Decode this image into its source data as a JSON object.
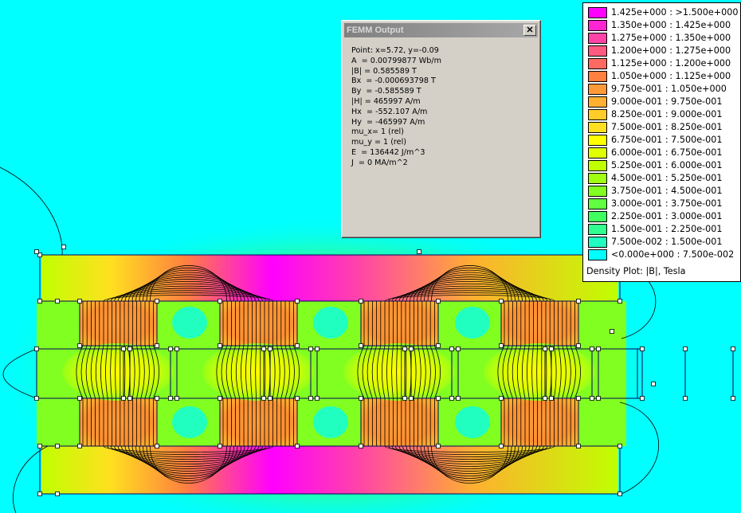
{
  "output_window": {
    "title": "FEMM Output",
    "lines": [
      "Point: x=5.72, y=-0.09",
      "A  = 0.00799877 Wb/m",
      "|B| = 0.585589 T",
      "Bx  = -0.000693798 T",
      "By  = -0.585589 T",
      "|H| = 465997 A/m",
      "Hx  = -552.107 A/m",
      "Hy  = -465997 A/m",
      "mu_x= 1 (rel)",
      "mu_y = 1 (rel)",
      "E  = 136442 J/m^3",
      "J  = 0 MA/m^2"
    ]
  },
  "legend": {
    "caption": "Density Plot: |B|, Tesla",
    "entries": [
      {
        "label": "1.425e+000 : >1.500e+000",
        "color": "#ff00ff"
      },
      {
        "label": "1.350e+000 : 1.425e+000",
        "color": "#ff26d2"
      },
      {
        "label": "1.275e+000 : 1.350e+000",
        "color": "#ff44a8"
      },
      {
        "label": "1.200e+000 : 1.275e+000",
        "color": "#ff5a80"
      },
      {
        "label": "1.125e+000 : 1.200e+000",
        "color": "#ff6a60"
      },
      {
        "label": "1.050e+000 : 1.125e+000",
        "color": "#ff8040"
      },
      {
        "label": "9.750e-001 : 1.050e+000",
        "color": "#ff9a38"
      },
      {
        "label": "9.000e-001 : 9.750e-001",
        "color": "#ffb030"
      },
      {
        "label": "8.250e-001 : 9.000e-001",
        "color": "#ffcc28"
      },
      {
        "label": "7.500e-001 : 8.250e-001",
        "color": "#ffe020"
      },
      {
        "label": "6.750e-001 : 7.500e-001",
        "color": "#ffff00"
      },
      {
        "label": "6.000e-001 : 6.750e-001",
        "color": "#e0ff00"
      },
      {
        "label": "5.250e-001 : 6.000e-001",
        "color": "#c0ff00"
      },
      {
        "label": "4.500e-001 : 5.250e-001",
        "color": "#a0ff10"
      },
      {
        "label": "3.750e-001 : 4.500e-001",
        "color": "#80ff20"
      },
      {
        "label": "3.000e-001 : 3.750e-001",
        "color": "#60ff40"
      },
      {
        "label": "2.250e-001 : 3.000e-001",
        "color": "#40ff60"
      },
      {
        "label": "1.500e-001 : 2.250e-001",
        "color": "#30ff90"
      },
      {
        "label": "7.500e-002 : 1.500e-001",
        "color": "#20ffc0"
      },
      {
        "label": "<0.000e+000 : 7.500e-002",
        "color": "#00ffff"
      }
    ]
  }
}
